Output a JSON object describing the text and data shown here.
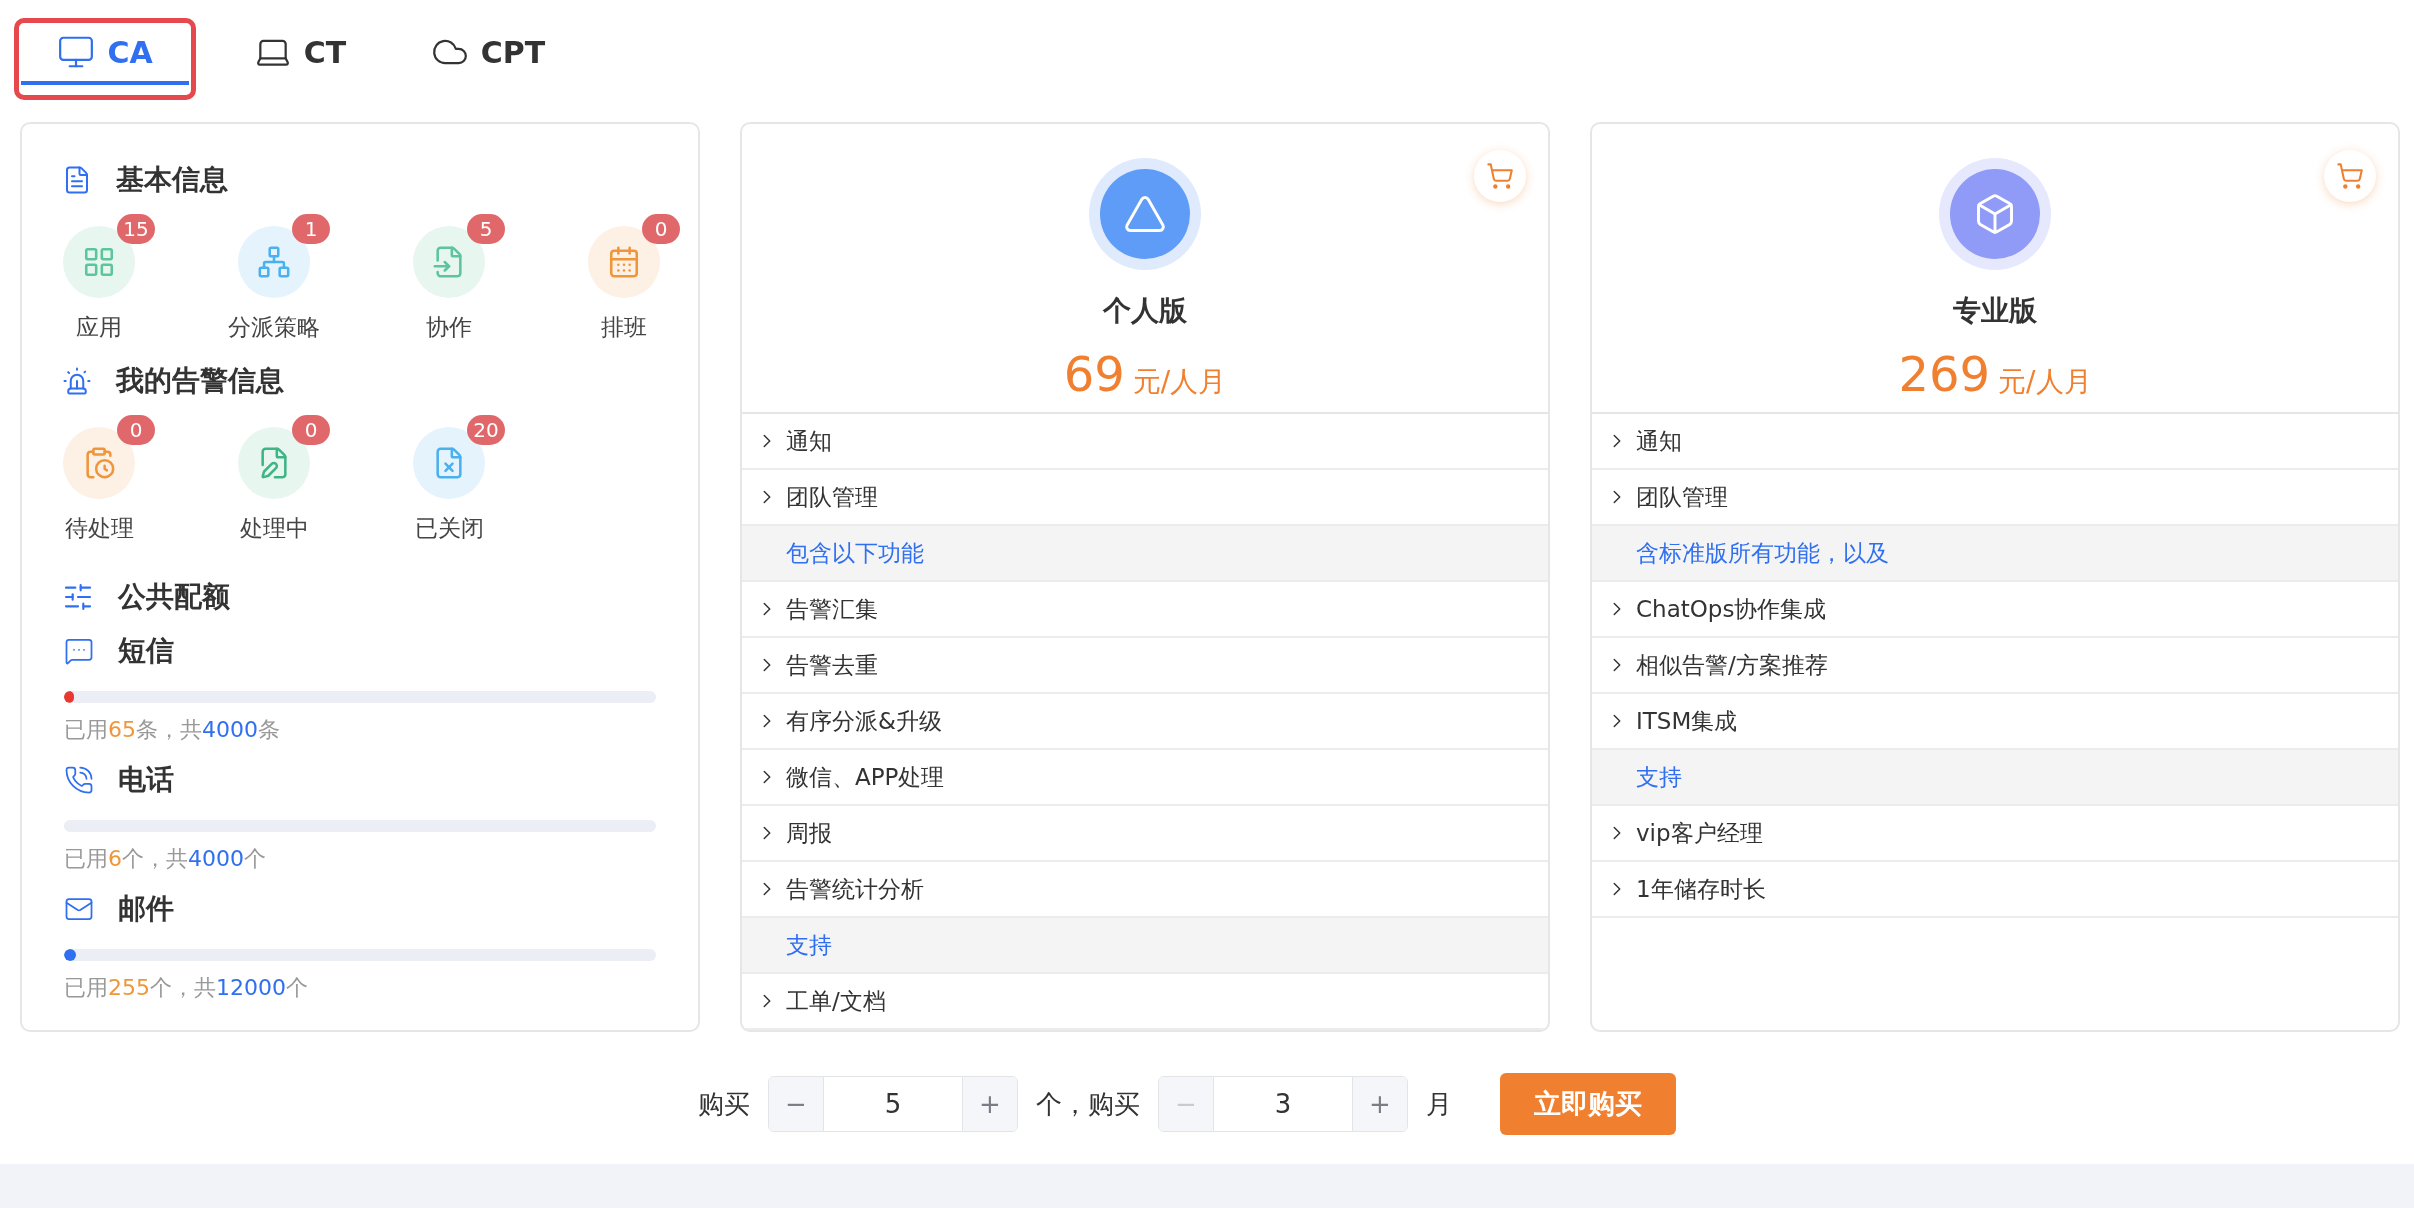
{
  "tabs": [
    {
      "label": "CA",
      "kind": "monitor",
      "selected": true
    },
    {
      "label": "CT",
      "kind": "laptop",
      "selected": false
    },
    {
      "label": "CPT",
      "kind": "cloud",
      "selected": false
    }
  ],
  "overview": {
    "sections": [
      {
        "title": "基本信息",
        "kind": "info",
        "items": [
          {
            "label": "应用",
            "count": "15",
            "kind": "apps"
          },
          {
            "label": "分派策略",
            "count": "1",
            "kind": "dispatch"
          },
          {
            "label": "协作",
            "count": "5",
            "kind": "collab"
          },
          {
            "label": "排班",
            "count": "0",
            "kind": "schedule"
          }
        ]
      },
      {
        "title": "我的告警信息",
        "kind": "alarm",
        "items": [
          {
            "label": "待处理",
            "count": "0",
            "kind": "pending"
          },
          {
            "label": "处理中",
            "count": "0",
            "kind": "processing"
          },
          {
            "label": "已关闭",
            "count": "20",
            "kind": "closed"
          }
        ]
      }
    ],
    "quota": {
      "title": "公共配额",
      "items": [
        {
          "name": "短信",
          "kind": "sms",
          "level": 0.016,
          "color": "#e8382f",
          "prefix": "已用",
          "used": "65",
          "middle": "条，共",
          "total": "4000",
          "suffix": "条"
        },
        {
          "name": "电话",
          "kind": "phone",
          "level": 0.0015,
          "prefix": "已用",
          "used": "6",
          "middle": "个，共",
          "total": "4000",
          "suffix": "个"
        },
        {
          "name": "邮件",
          "kind": "mail",
          "level": 0.021,
          "color": "#2f6ff0",
          "prefix": "已用",
          "used": "255",
          "middle": "个，共",
          "total": "12000",
          "suffix": "个"
        }
      ]
    }
  },
  "plans": [
    {
      "name": "个人版",
      "kind": "personal",
      "color": "#5e9cf7",
      "price": "69",
      "unit": "元/人月",
      "features": [
        {
          "kind": "feature",
          "label": "通知"
        },
        {
          "kind": "feature",
          "label": "团队管理"
        },
        {
          "kind": "group",
          "label": "包含以下功能"
        },
        {
          "kind": "feature",
          "label": "告警汇集"
        },
        {
          "kind": "feature",
          "label": "告警去重"
        },
        {
          "kind": "feature",
          "label": "有序分派&升级"
        },
        {
          "kind": "feature",
          "label": "微信、APP处理"
        },
        {
          "kind": "feature",
          "label": "周报"
        },
        {
          "kind": "feature",
          "label": "告警统计分析"
        },
        {
          "kind": "group",
          "label": "支持"
        },
        {
          "kind": "feature",
          "label": "工单/文档"
        }
      ]
    },
    {
      "name": "专业版",
      "kind": "pro",
      "color": "#8f9bf7",
      "price": "269",
      "unit": "元/人月",
      "features": [
        {
          "kind": "feature",
          "label": "通知"
        },
        {
          "kind": "feature",
          "label": "团队管理"
        },
        {
          "kind": "group",
          "label": "含标准版所有功能，以及"
        },
        {
          "kind": "feature",
          "label": "ChatOps协作集成"
        },
        {
          "kind": "feature",
          "label": "相似告警/方案推荐"
        },
        {
          "kind": "feature",
          "label": "ITSM集成"
        },
        {
          "kind": "group",
          "label": "支持"
        },
        {
          "kind": "feature",
          "label": "vip客户经理"
        },
        {
          "kind": "feature",
          "label": "1年储存时长"
        }
      ]
    }
  ],
  "purchase": {
    "label_1": "购买",
    "count": {
      "minus": "−",
      "value": "5",
      "plus": "+",
      "minus_disabled": false
    },
    "label_2": "个，购买",
    "months": {
      "minus": "−",
      "value": "3",
      "plus": "+",
      "minus_disabled": true
    },
    "label_3": "月",
    "button": "立即购买"
  }
}
